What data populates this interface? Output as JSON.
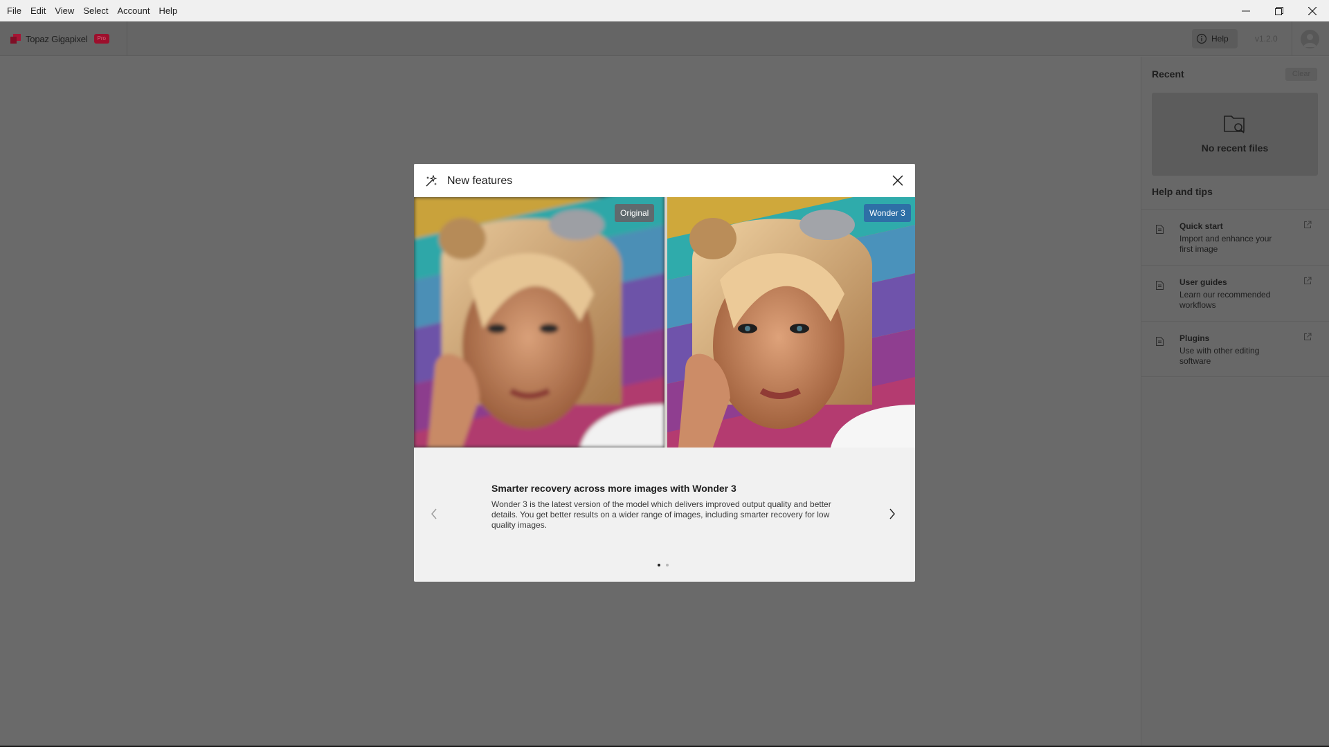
{
  "menu": [
    "File",
    "Edit",
    "View",
    "Select",
    "Account",
    "Help"
  ],
  "window_controls": [
    "minimize-icon",
    "restore-icon",
    "close-icon"
  ],
  "header": {
    "app_name": "Topaz Gigapixel",
    "badge": "Pro",
    "help_label": "Help",
    "version": "v1.2.0"
  },
  "sidebar": {
    "recent_title": "Recent",
    "clear_label": "Clear",
    "no_recent": "No recent files",
    "help_title": "Help and tips",
    "tips": [
      {
        "title": "Quick start",
        "desc": "Import and enhance your first image"
      },
      {
        "title": "User guides",
        "desc": "Learn our recommended workflows"
      },
      {
        "title": "Plugins",
        "desc": "Use with other editing software"
      }
    ]
  },
  "modal": {
    "title": "New features",
    "label_original": "Original",
    "label_enhanced": "Wonder 3",
    "feature_title": "Smarter recovery across more images with Wonder 3",
    "feature_desc": "Wonder 3 is the latest version of the model which delivers improved output quality and better details. You get better results on a wider range of images, including smarter recovery for low quality images.",
    "page": 1,
    "page_count": 2
  },
  "colors": {
    "brand_accent": "#9c0f2c",
    "enhanced_label": "#2e6fa6",
    "overlay": "#6a6a6a"
  }
}
